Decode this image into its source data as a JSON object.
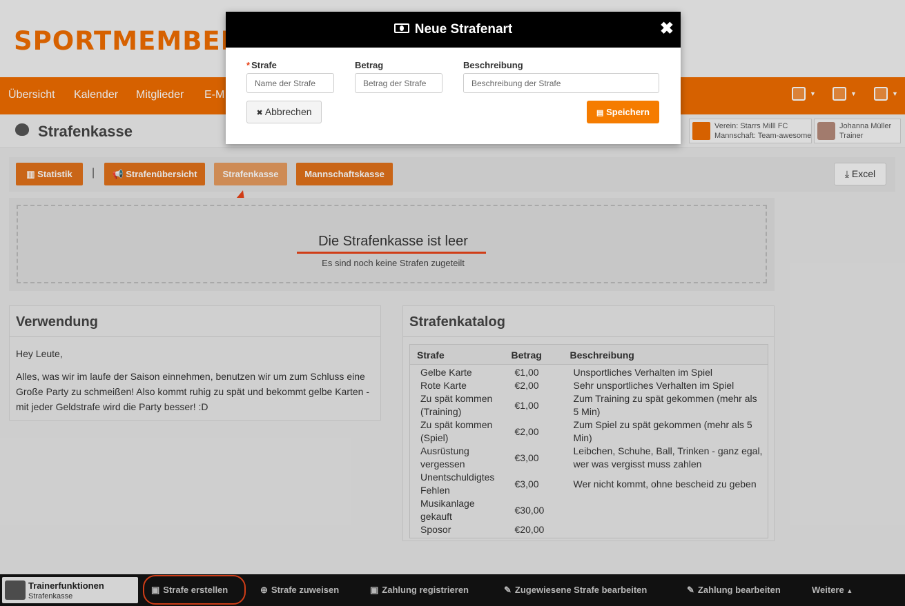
{
  "brand": {
    "logo": "SPORTMEMBER",
    "accent": "#ef6c00"
  },
  "nav": {
    "items": [
      "Übersicht",
      "Kalender",
      "Mitglieder",
      "E-M"
    ]
  },
  "page": {
    "title": "Strafenkasse"
  },
  "context": {
    "club": "Verein: Starrs Milll FC",
    "team": "Mannschaft: Team-awesome",
    "user": "Johanna Müller",
    "role": "Trainer"
  },
  "toolbar": {
    "statistik": "Statistik",
    "uebersicht": "Strafenübersicht",
    "kasse": "Strafenkasse",
    "mannschaft": "Mannschaftskasse",
    "excel": "Excel"
  },
  "empty": {
    "title": "Die Strafenkasse ist leer",
    "subtitle": "Es sind noch keine Strafen zugeteilt"
  },
  "verwendung": {
    "title": "Verwendung",
    "greeting": "Hey Leute,",
    "text": "Alles, was wir im laufe der Saison einnehmen, benutzen wir um zum Schluss eine Große Party zu schmeißen! Also kommt ruhig zu spät und bekommt gelbe Karten - mit jeder Geldstrafe wird die Party besser! :D"
  },
  "katalog": {
    "title": "Strafenkatalog",
    "headers": [
      "Strafe",
      "Betrag",
      "Beschreibung"
    ],
    "rows": [
      [
        "Gelbe Karte",
        "€1,00",
        "Unsportliches Verhalten im Spiel"
      ],
      [
        "Rote Karte",
        "€2,00",
        "Sehr unsportliches Verhalten im Spiel"
      ],
      [
        "Zu spät kommen (Training)",
        "€1,00",
        "Zum Training zu spät gekommen (mehr als 5 Min)"
      ],
      [
        "Zu spät kommen (Spiel)",
        "€2,00",
        "Zum Spiel zu spät gekommen (mehr als 5 Min)"
      ],
      [
        "Ausrüstung vergessen",
        "€3,00",
        "Leibchen, Schuhe, Ball, Trinken - ganz egal, wer was vergisst muss zahlen"
      ],
      [
        "Unentschuldigtes Fehlen",
        "€3,00",
        "Wer nicht kommt, ohne bescheid zu geben"
      ],
      [
        "Musikanlage gekauft",
        "€30,00",
        ""
      ],
      [
        "Sposor",
        "€20,00",
        ""
      ]
    ]
  },
  "bottom": {
    "tf_title": "Trainerfunktionen",
    "tf_sub": "Strafenkasse",
    "items": [
      "Strafe erstellen",
      "Strafe zuweisen",
      "Zahlung registrieren",
      "Zugewiesene Strafe bearbeiten",
      "Zahlung bearbeiten",
      "Weitere"
    ]
  },
  "modal": {
    "title": "Neue Strafenart",
    "label_strafe": "Strafe",
    "label_betrag": "Betrag",
    "label_beschreibung": "Beschreibung",
    "ph_strafe": "Name der Strafe",
    "ph_betrag": "Betrag der Strafe",
    "ph_beschreibung": "Beschreibung der Strafe",
    "cancel": "Abbrechen",
    "save": "Speichern"
  }
}
